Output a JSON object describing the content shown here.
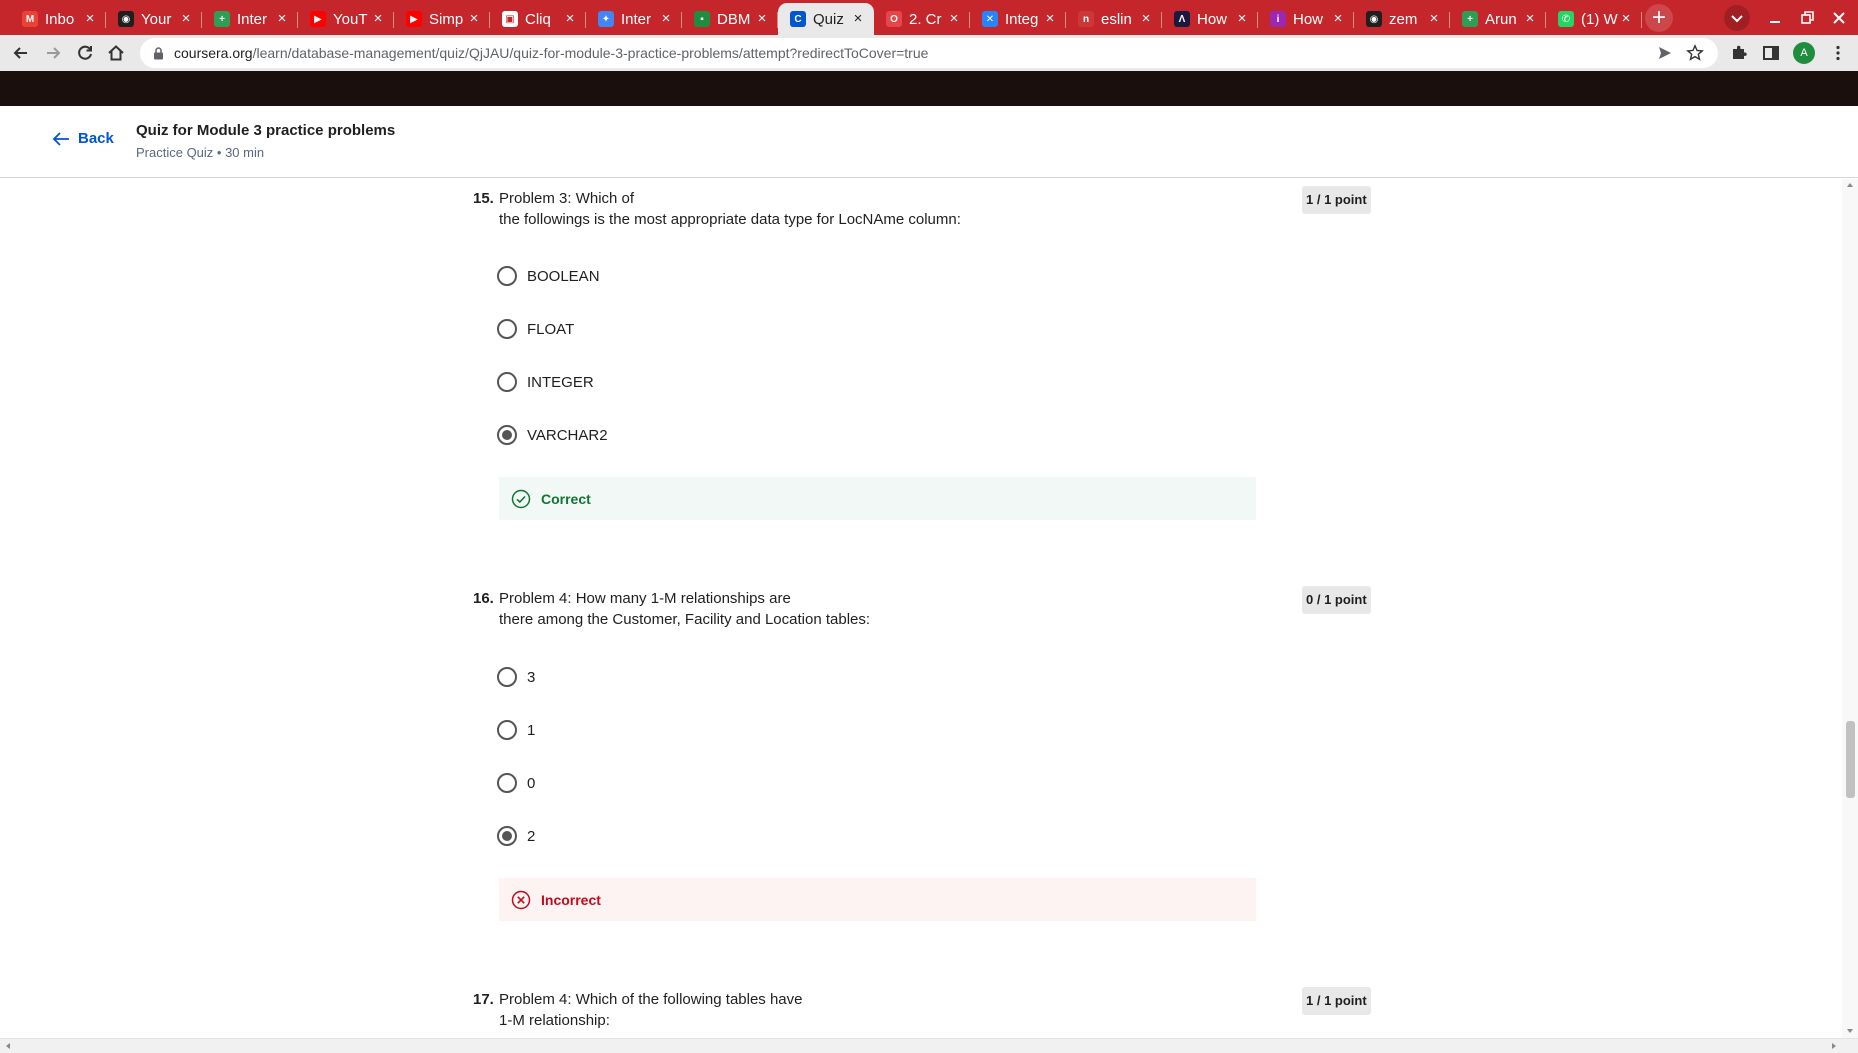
{
  "browser": {
    "tabs": [
      {
        "title": "Inbo",
        "favicon": "gmail-icon",
        "color": "#ea4335",
        "glyph": "M"
      },
      {
        "title": "Your",
        "favicon": "github-icon",
        "color": "#1f1f1f",
        "glyph": "◉"
      },
      {
        "title": "Inter",
        "favicon": "plus-doc-icon",
        "color": "#2e9e54",
        "glyph": "+"
      },
      {
        "title": "YouT",
        "favicon": "youtube-icon",
        "color": "#ff0000",
        "glyph": "▶"
      },
      {
        "title": "Simp",
        "favicon": "youtube-icon",
        "color": "#ff0000",
        "glyph": "▶"
      },
      {
        "title": "Cliq",
        "favicon": "chat-icon",
        "color": "#ffffff",
        "glyph": "▣"
      },
      {
        "title": "Inter",
        "favicon": "puzzle-icon",
        "color": "#4285f4",
        "glyph": "✦"
      },
      {
        "title": "DBM",
        "favicon": "classroom-icon",
        "color": "#1e8e3e",
        "glyph": "▪"
      },
      {
        "title": "Quiz",
        "favicon": "coursera-icon",
        "color": "#0056d2",
        "glyph": "C",
        "active": true
      },
      {
        "title": "2. Cr",
        "favicon": "opera-icon",
        "color": "#e8454a",
        "glyph": "O"
      },
      {
        "title": "Integ",
        "favicon": "confluence-icon",
        "color": "#2684ff",
        "glyph": "✕"
      },
      {
        "title": "eslin",
        "favicon": "npm-icon",
        "color": "#cb3837",
        "glyph": "n"
      },
      {
        "title": "How",
        "favicon": "dev-icon",
        "color": "#1a1a40",
        "glyph": "Λ"
      },
      {
        "title": "How",
        "favicon": "info-icon",
        "color": "#9c27b0",
        "glyph": "i"
      },
      {
        "title": "zem",
        "favicon": "github-icon",
        "color": "#1f1f1f",
        "glyph": "◉"
      },
      {
        "title": "Arun",
        "favicon": "plus-doc-icon",
        "color": "#2e9e54",
        "glyph": "+"
      },
      {
        "title": "(1) W",
        "favicon": "whatsapp-icon",
        "color": "#25d366",
        "glyph": "✆"
      }
    ],
    "url_host": "coursera.org",
    "url_path": "/learn/database-management/quiz/QjJAU/quiz-for-module-3-practice-problems/attempt?redirectToCover=true",
    "profile_initial": "A"
  },
  "header": {
    "back_label": "Back",
    "title": "Quiz for Module 3 practice problems",
    "meta": "Practice Quiz • 30 min"
  },
  "questions": [
    {
      "number": "15.",
      "line1": "Problem 3: Which of",
      "line2": "the followings is the most appropriate data type for LocNAme column:",
      "points": "1 / 1 point",
      "options": [
        "BOOLEAN",
        "FLOAT",
        "INTEGER",
        "VARCHAR2"
      ],
      "selected": 3,
      "feedback": "Correct",
      "feedback_status": "correct"
    },
    {
      "number": "16.",
      "line1": "Problem 4: How many 1-M relationships are",
      "line2": "there among the Customer, Facility and Location tables:",
      "points": "0 / 1 point",
      "options": [
        "3",
        "1",
        "0",
        "2"
      ],
      "selected": 3,
      "feedback": "Incorrect",
      "feedback_status": "incorrect"
    },
    {
      "number": "17.",
      "line1": "Problem 4: Which of the following tables have",
      "line2": "1-M relationship:",
      "points": "1 / 1 point"
    }
  ],
  "colors": {
    "tab_strip": "#c5262b",
    "link_blue": "#0056d2",
    "correct_green": "#137333",
    "incorrect_red": "#c00b1d"
  }
}
